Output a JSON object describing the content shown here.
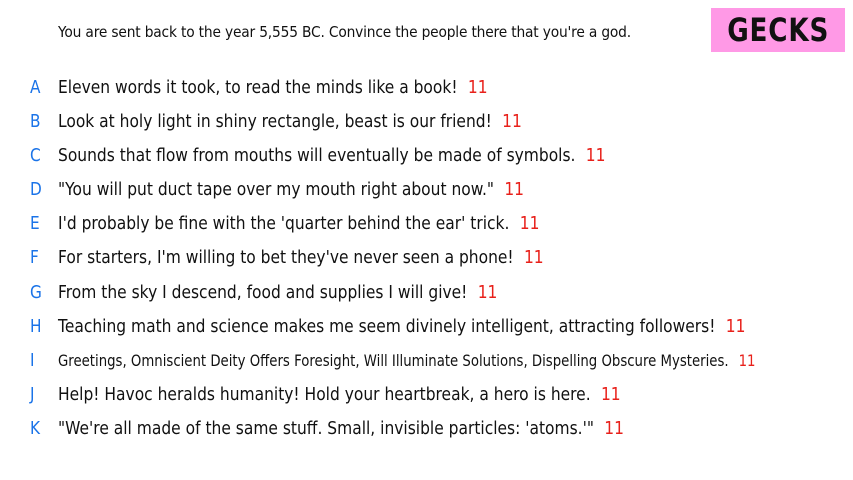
{
  "prompt": "You are sent back to the year 5,555 BC. Convince the people there that you're a god.",
  "badge": "GECKS",
  "colors": {
    "badge_bg": "#ff99e6",
    "letter": "#1a73e8",
    "count": "#e8201a"
  },
  "answers": [
    {
      "letter": "A",
      "text": "Eleven words it took, to read the minds like a book!",
      "count": "11"
    },
    {
      "letter": "B",
      "text": "Look at holy light in shiny rectangle, beast is our friend!",
      "count": "11"
    },
    {
      "letter": "C",
      "text": "Sounds that flow from mouths will eventually be made of symbols.",
      "count": "11"
    },
    {
      "letter": "D",
      "text": "\"You will put duct tape over my mouth right about now.\"",
      "count": "11"
    },
    {
      "letter": "E",
      "text": "I'd probably be fine with the 'quarter behind the ear' trick.",
      "count": "11"
    },
    {
      "letter": "F",
      "text": "For starters, I'm willing to bet they've never seen a phone!",
      "count": "11"
    },
    {
      "letter": "G",
      "text": "From the sky I descend, food and supplies I will give!",
      "count": "11"
    },
    {
      "letter": "H",
      "text": "Teaching math and science makes me seem divinely intelligent, attracting followers!",
      "count": "11"
    },
    {
      "letter": "I",
      "text": "Greetings, Omniscient Deity Offers Foresight, Will Illuminate Solutions, Dispelling Obscure Mysteries.",
      "count": "11"
    },
    {
      "letter": "J",
      "text": "Help! Havoc heralds humanity! Hold your heartbreak, a hero is here.",
      "count": "11"
    },
    {
      "letter": "K",
      "text": "\"We're all made of the same stuff. Small, invisible particles: 'atoms.'\"",
      "count": "11"
    }
  ]
}
